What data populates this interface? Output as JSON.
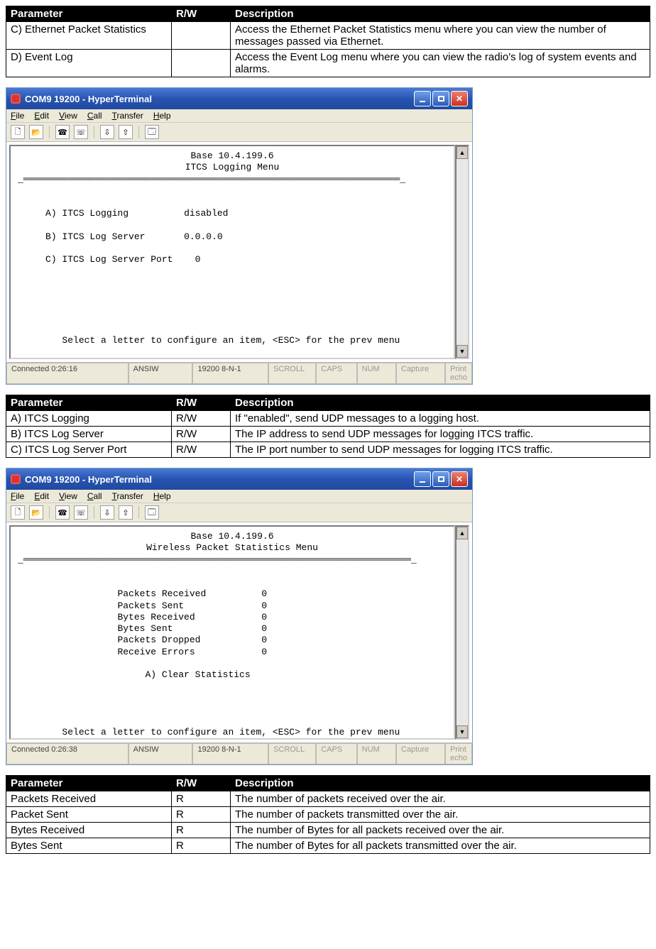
{
  "table1": {
    "headers": [
      "Parameter",
      "R/W",
      "Description"
    ],
    "rows": [
      {
        "param": "C) Ethernet Packet Statistics",
        "rw": "",
        "desc": "Access the Ethernet Packet Statistics menu where you can view the number of messages passed via Ethernet."
      },
      {
        "param": "D) Event Log",
        "rw": "",
        "desc": "Access the Event Log menu where you can view the radio's log of system events and alarms."
      }
    ]
  },
  "window1": {
    "title": "COM9 19200 - HyperTerminal",
    "menus": [
      "File",
      "Edit",
      "View",
      "Call",
      "Transfer",
      "Help"
    ],
    "terminal_header_line1": "Base 10.4.199.6",
    "terminal_header_line2": "ITCS Logging Menu",
    "terminal_hr": "_════════════════════════════════════════════════════════════════════_",
    "items": [
      {
        "label": "A) ITCS Logging",
        "value": "disabled"
      },
      {
        "label": "B) ITCS Log Server",
        "value": "0.0.0.0"
      },
      {
        "label": "C) ITCS Log Server Port",
        "value": "0"
      }
    ],
    "footer": "Select a letter to configure an item, <ESC> for the prev menu",
    "status": {
      "conn": "Connected 0:26:16",
      "emu": "ANSIW",
      "cfg": "19200 8-N-1",
      "scroll": "SCROLL",
      "caps": "CAPS",
      "num": "NUM",
      "cap": "Capture",
      "echo": "Print echo"
    }
  },
  "table2": {
    "headers": [
      "Parameter",
      "R/W",
      "Description"
    ],
    "rows": [
      {
        "param": "A) ITCS Logging",
        "rw": "R/W",
        "desc": "If \"enabled\", send UDP messages to a logging host."
      },
      {
        "param": "B) ITCS Log Server",
        "rw": "R/W",
        "desc": "The IP address to send UDP messages for logging ITCS traffic."
      },
      {
        "param": "C) ITCS Log Server Port",
        "rw": "R/W",
        "desc": "The IP port number to send UDP messages for logging ITCS traffic."
      }
    ]
  },
  "window2": {
    "title": "COM9 19200 - HyperTerminal",
    "menus": [
      "File",
      "Edit",
      "View",
      "Call",
      "Transfer",
      "Help"
    ],
    "terminal_header_line1": "Base 10.4.199.6",
    "terminal_header_line2": "Wireless Packet Statistics Menu",
    "terminal_hr": "_══════════════════════════════════════════════════════════════════════_",
    "stats": [
      {
        "label": "Packets Received",
        "value": "0"
      },
      {
        "label": "Packets Sent",
        "value": "0"
      },
      {
        "label": "Bytes Received",
        "value": "0"
      },
      {
        "label": "Bytes Sent",
        "value": "0"
      },
      {
        "label": "Packets Dropped",
        "value": "0"
      },
      {
        "label": "Receive Errors",
        "value": "0"
      }
    ],
    "option": "A) Clear Statistics",
    "footer": "Select a letter to configure an item, <ESC> for the prev menu",
    "status": {
      "conn": "Connected 0:26:38",
      "emu": "ANSIW",
      "cfg": "19200 8-N-1",
      "scroll": "SCROLL",
      "caps": "CAPS",
      "num": "NUM",
      "cap": "Capture",
      "echo": "Print echo"
    }
  },
  "table3": {
    "headers": [
      "Parameter",
      "R/W",
      "Description"
    ],
    "rows": [
      {
        "param": "Packets Received",
        "rw": "R",
        "desc": "The number of packets received over the air."
      },
      {
        "param": "Packet Sent",
        "rw": "R",
        "desc": "The number of packets transmitted over the air."
      },
      {
        "param": "Bytes Received",
        "rw": "R",
        "desc": "The number of Bytes for all packets received over the air."
      },
      {
        "param": "Bytes Sent",
        "rw": "R",
        "desc": "The number of Bytes for all packets transmitted over the air."
      }
    ]
  }
}
